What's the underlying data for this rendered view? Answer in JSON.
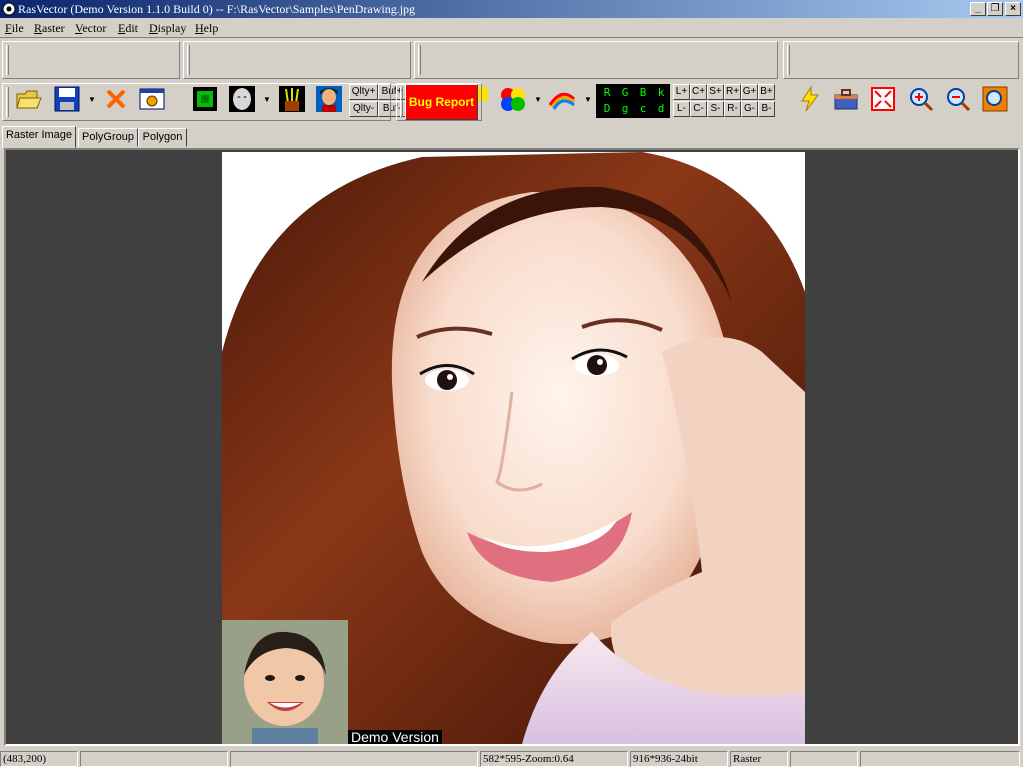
{
  "window": {
    "title": "RasVector (Demo Version 1.1.0 Build 0) -- F:\\RasVector\\Samples\\PenDrawing.jpg",
    "minimize": "_",
    "restore": "❐",
    "close": "×"
  },
  "menu": [
    "File",
    "Raster",
    "Vector",
    "Edit",
    "Display",
    "Help"
  ],
  "toolbar": {
    "quality": {
      "qlty_plus": "Qlty+",
      "qlty_minus": "Qlty-",
      "buf_plus": "Buf+",
      "buf_minus": "Buf-"
    },
    "rgb_panel": {
      "top": [
        "R",
        "G",
        "B",
        "k"
      ],
      "bottom": [
        "D",
        "g",
        "c",
        "d"
      ]
    },
    "channel_buttons_top": [
      "L+",
      "C+",
      "S+",
      "R+",
      "G+",
      "B+"
    ],
    "channel_buttons_bottom": [
      "L-",
      "C-",
      "S-",
      "R-",
      "G-",
      "B-"
    ],
    "bug_report": "Bug Report"
  },
  "tabs": [
    "Raster Image",
    "PolyGroup",
    "Polygon"
  ],
  "canvas": {
    "watermark": "Demo Version"
  },
  "status": {
    "coords": "(483,200)",
    "zoom": "582*595-Zoom:0.64",
    "image_info": "916*936-24bit",
    "mode": "Raster"
  },
  "colors": {
    "accent": "#0a246a",
    "bug_report_bg": "#ff0000",
    "bug_report_text": "#ffff00",
    "rgb_text": "#00ff00"
  }
}
